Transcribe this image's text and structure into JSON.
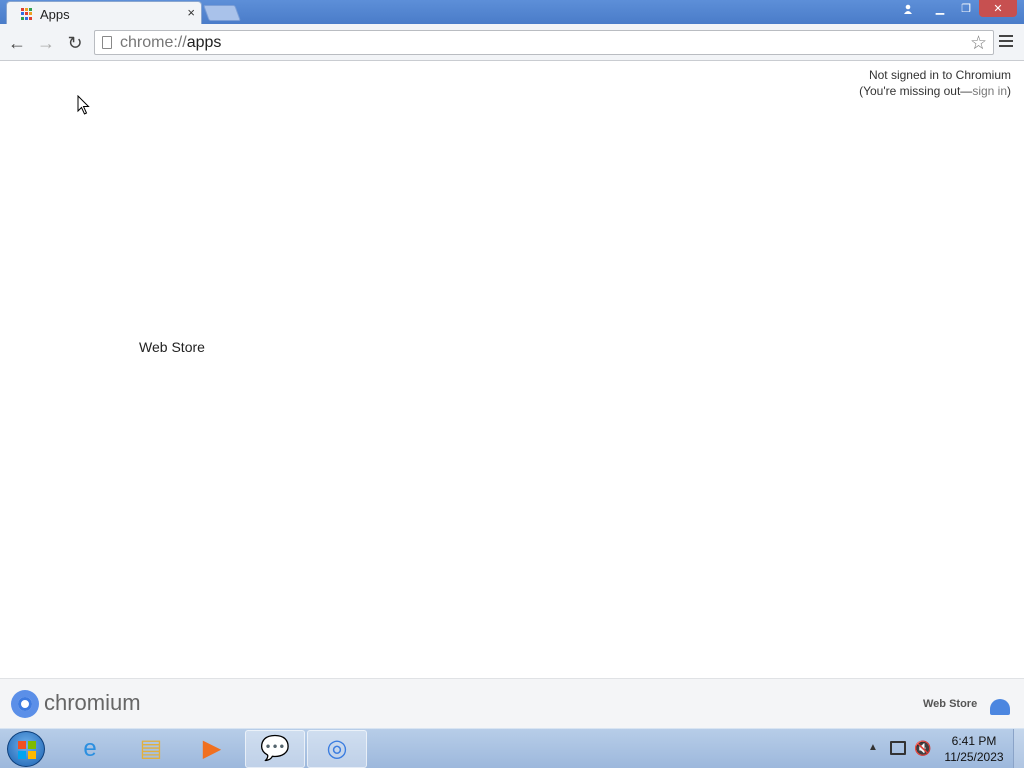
{
  "browser": {
    "tab": {
      "title": "Apps",
      "close_glyph": "×"
    },
    "window_controls": {
      "minimize": "▁",
      "maximize": "❐",
      "close": "✕"
    },
    "toolbar": {
      "back_glyph": "←",
      "forward_glyph": "→",
      "reload_glyph": "↻",
      "url_scheme": "chrome://",
      "url_host": "apps",
      "star_glyph": "☆"
    }
  },
  "content": {
    "signin_line1": "Not signed in to Chromium",
    "signin_line2_prefix": "(You're missing out—",
    "signin_link": "sign in",
    "signin_line2_suffix": ")",
    "apps": [
      {
        "label": "Web Store"
      }
    ]
  },
  "footer": {
    "brand": "chromium",
    "store_link": "Web Store"
  },
  "taskbar": {
    "clock_time": "6:41 PM",
    "clock_date": "11/25/2023",
    "tray_up_glyph": "▲",
    "items": [
      {
        "name": "internet-explorer",
        "glyph": "e",
        "color": "#2b8fe0"
      },
      {
        "name": "file-explorer",
        "glyph": "▤",
        "color": "#e0b040"
      },
      {
        "name": "media-player",
        "glyph": "▶",
        "color": "#f07020"
      },
      {
        "name": "messenger",
        "glyph": "💬",
        "color": "#e0b020"
      },
      {
        "name": "chromium",
        "glyph": "◎",
        "color": "#3b7de0"
      }
    ]
  },
  "colors": {
    "titlebar": "#4a7cc9",
    "accent": "#3f7be0",
    "windows_flag": [
      "#f25022",
      "#7fba00",
      "#00a4ef",
      "#ffb900"
    ],
    "apps_favicon": [
      "#e04030",
      "#f0a020",
      "#30a050",
      "#3070e0",
      "#e04030",
      "#f0a020",
      "#30a050",
      "#3070e0",
      "#e04030"
    ]
  }
}
